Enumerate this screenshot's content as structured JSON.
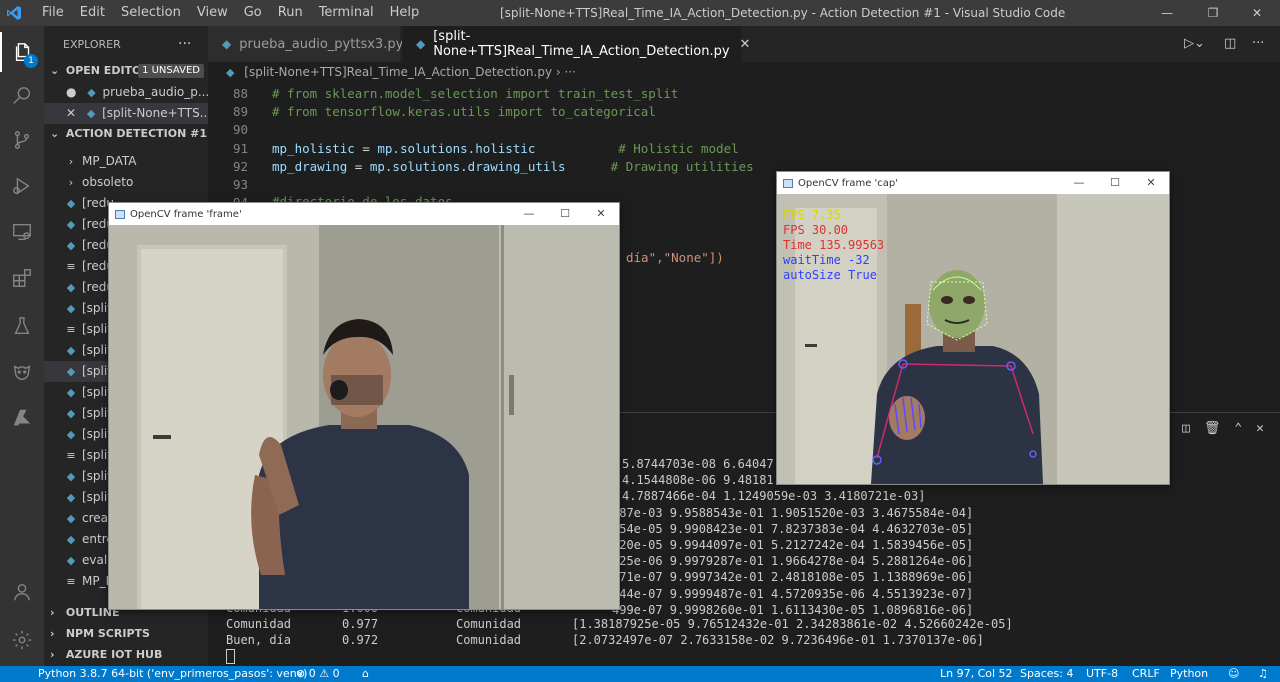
{
  "titlebar": {
    "menus": [
      "File",
      "Edit",
      "Selection",
      "View",
      "Go",
      "Run",
      "Terminal",
      "Help"
    ],
    "title": "[split-None+TTS]Real_Time_IA_Action_Detection.py - Action Detection #1 - Visual Studio Code"
  },
  "activitybar": {
    "explorer_badge": "1",
    "icons": [
      "files-icon",
      "search-icon",
      "source-control-icon",
      "run-debug-icon",
      "remote-explorer-icon",
      "extensions-icon",
      "testing-icon",
      "gitlens-icon",
      "azure-icon",
      "account-icon",
      "settings-gear-icon"
    ]
  },
  "sidebar": {
    "header": "EXPLORER",
    "more": "···",
    "open_editors_label": "OPEN EDITORS",
    "unsaved_badge": "1 UNSAVED",
    "open_editors": [
      {
        "name": "prueba_audio_p...",
        "marker": "●"
      },
      {
        "name": "[split-None+TTS...",
        "marker": "✕"
      }
    ],
    "project_label": "ACTION DETECTION #1",
    "files": [
      {
        "name": "MP_DATA",
        "kind": "folder"
      },
      {
        "name": "obsoleto",
        "kind": "folder"
      },
      {
        "name": "[redu",
        "kind": "py"
      },
      {
        "name": "[redu",
        "kind": "py"
      },
      {
        "name": "[redu",
        "kind": "py"
      },
      {
        "name": "[redu",
        "kind": "md"
      },
      {
        "name": "[redu",
        "kind": "py"
      },
      {
        "name": "[split-",
        "kind": "py"
      },
      {
        "name": "[split-",
        "kind": "md"
      },
      {
        "name": "[split-",
        "kind": "py"
      },
      {
        "name": "[split-",
        "kind": "py"
      },
      {
        "name": "[split]",
        "kind": "py"
      },
      {
        "name": "[split]",
        "kind": "py"
      },
      {
        "name": "[split]",
        "kind": "py"
      },
      {
        "name": "[split]",
        "kind": "md"
      },
      {
        "name": "[split]",
        "kind": "py"
      },
      {
        "name": "[split]",
        "kind": "py"
      },
      {
        "name": "crear_",
        "kind": "py"
      },
      {
        "name": "entren",
        "kind": "py"
      },
      {
        "name": "evalua",
        "kind": "py"
      },
      {
        "name": "MP_D",
        "kind": "md"
      }
    ],
    "outline_label": "OUTLINE",
    "npm_label": "NPM SCRIPTS",
    "azure_label": "AZURE IOT HUB"
  },
  "editor": {
    "tabs": [
      {
        "label": "prueba_audio_pyttsx3.py",
        "state": "●"
      },
      {
        "label": "[split-None+TTS]Real_Time_IA_Action_Detection.py",
        "state": "✕"
      }
    ],
    "breadcrumb": "[split-None+TTS]Real_Time_IA_Action_Detection.py",
    "breadcrumb_sep": "›",
    "lines": [
      {
        "n": "88",
        "segments": [
          {
            "t": "# from sklearn.model_selection import train_test_split",
            "c": "cmt"
          }
        ]
      },
      {
        "n": "89",
        "segments": [
          {
            "t": "# from tensorflow.keras.utils import to_categorical",
            "c": "cmt"
          }
        ]
      },
      {
        "n": "90",
        "segments": []
      },
      {
        "n": "91",
        "segments": [
          {
            "t": "mp_holistic",
            "c": "var"
          },
          {
            "t": " = ",
            "c": ""
          },
          {
            "t": "mp.solutions.holistic",
            "c": "var"
          },
          {
            "t": "           # Holistic model",
            "c": "cmt"
          }
        ]
      },
      {
        "n": "92",
        "segments": [
          {
            "t": "mp_drawing",
            "c": "var"
          },
          {
            "t": " = ",
            "c": ""
          },
          {
            "t": "mp.solutions.drawing_utils",
            "c": "var"
          },
          {
            "t": "      # Drawing utilities",
            "c": "cmt"
          }
        ]
      },
      {
        "n": "93",
        "segments": []
      },
      {
        "n": "94",
        "segments": []
      }
    ],
    "hidden_snippet_1": "#directorio de los datos",
    "hidden_snippet_2": "día\",\"None\"])"
  },
  "terminal": {
    "partial_lines": [
      "5.8744703e-08 6.64047",
      "4.1544808e-06 9.48181",
      "4.7887466e-04 1.1249059e-03 3.4180721e-03]",
      "587e-03 9.9588543e-01 1.9051520e-03 3.4675584e-04]",
      "154e-05 9.9908423e-01 7.8237383e-04 4.4632703e-05]",
      "620e-05 9.9944097e-01 5.2127242e-04 1.5839456e-05]",
      "525e-06 9.9979287e-01 1.9664278e-04 5.2881264e-06]",
      "371e-07 9.9997342e-01 2.4818108e-05 1.1388969e-06]",
      "144e-07 9.9999487e-01 4.5720935e-06 4.5513923e-07]",
      "499e-07 9.9998260e-01 1.6113430e-05 1.0896816e-06]"
    ],
    "full_rows": [
      {
        "label": "Comunidad",
        "score": "1.000",
        "pred": "Comunidad",
        "vals": ""
      },
      {
        "label": "Comunidad",
        "score": "0.977",
        "pred": "Comunidad",
        "vals": "[1.38187925e-05 9.76512432e-01 2.34283861e-02 4.52660242e-05]"
      },
      {
        "label": "Buen, día",
        "score": "0.972",
        "pred": "Comunidad",
        "vals": "[2.0732497e-07 2.7633158e-02 9.7236496e-01 1.7370137e-06]"
      }
    ]
  },
  "statusbar": {
    "python": "Python 3.8.7 64-bit ('env_primeros_pasos': venv)",
    "problems": "⊗ 0 ⚠ 0",
    "position": "Ln 97, Col 52",
    "spaces": "Spaces: 4",
    "encoding": "UTF-8",
    "eol": "CRLF",
    "language": "Python"
  },
  "cv_frame": {
    "title": "OpenCV frame 'frame'"
  },
  "cv_cap": {
    "title": "OpenCV frame 'cap'",
    "overlay": [
      {
        "text": "FPS 7.35",
        "color": "#d8d800"
      },
      {
        "text": "FPS 30.00",
        "color": "#e03030"
      },
      {
        "text": "Time 135.99563",
        "color": "#e03030"
      },
      {
        "text": "waitTime -32",
        "color": "#3040ff"
      },
      {
        "text": "autoSize True",
        "color": "#3040ff"
      }
    ]
  },
  "colors": {
    "accent": "#007acc",
    "comment": "#6a9955",
    "variable": "#9cdcfe"
  }
}
